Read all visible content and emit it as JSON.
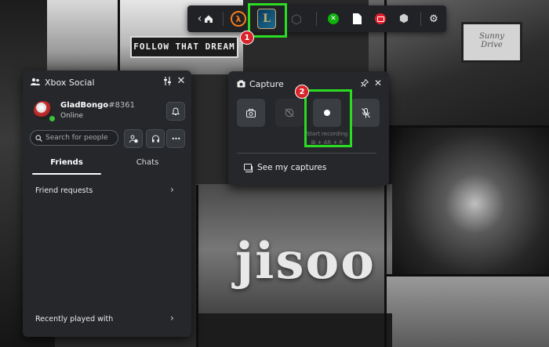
{
  "game_bar": {
    "back_glyph": "‹",
    "home_icon": "home-icon",
    "apps": [
      {
        "name": "half-life-icon",
        "glyph": "λ",
        "color": "#f57c1a"
      },
      {
        "name": "league-of-legends-icon",
        "glyph": "L",
        "color": "#c8aa6e"
      },
      {
        "name": "extension-icon",
        "glyph": "⬡",
        "color": "#5a5d62"
      },
      {
        "name": "xbox-icon",
        "glyph": "✕",
        "color": "#10b010"
      },
      {
        "name": "document-icon",
        "glyph": "▮",
        "color": "#ffffff"
      },
      {
        "name": "cast-icon",
        "glyph": "●",
        "color": "#e1202e"
      },
      {
        "name": "epic-icon",
        "glyph": "⬢",
        "color": "#cfcfcf"
      }
    ],
    "settings_glyph": "⚙",
    "accent": "#2bdc22"
  },
  "steps": [
    "1",
    "2"
  ],
  "social": {
    "title": "Xbox Social",
    "user": {
      "name": "GladBongo",
      "tag": "#8361",
      "status": "Online"
    },
    "search_placeholder": "Search for people",
    "tabs": [
      "Friends",
      "Chats"
    ],
    "friend_requests": "Friend requests",
    "recently_played": "Recently played with",
    "more_glyph": "•••"
  },
  "capture": {
    "title": "Capture",
    "record_tooltip": "Start recording",
    "shortcut": "⊞ + Alt + R",
    "see_captures": "See my captures"
  }
}
